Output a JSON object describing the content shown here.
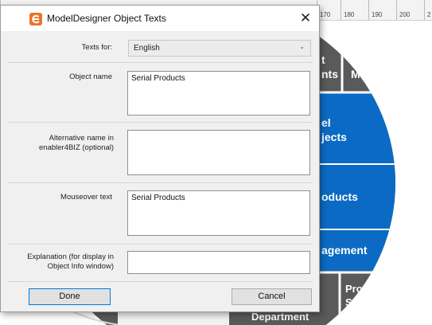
{
  "ruler": {
    "ticks": [
      "60",
      "170",
      "180",
      "190",
      "200",
      "2"
    ]
  },
  "background": {
    "labels": [
      {
        "id": "personel",
        "text": "Personel\nManagement"
      },
      {
        "id": "t-frag",
        "text": "t"
      },
      {
        "id": "nts-frag",
        "text": "nts"
      },
      {
        "id": "el-frag",
        "text": "el"
      },
      {
        "id": "jects-frag",
        "text": "jects"
      },
      {
        "id": "oducts-frag",
        "text": "oducts"
      },
      {
        "id": "agement-frag",
        "text": "agement"
      },
      {
        "id": "provide",
        "text": "Provide\nStandards"
      },
      {
        "id": "department",
        "text": "Department"
      }
    ],
    "colors": {
      "blue": "#0b6bc4",
      "blue_dark": "#0a5aa8",
      "gray": "#5a5a5a",
      "white": "#ffffff"
    }
  },
  "dialog": {
    "icon": "app-logo-icon",
    "title": "ModelDesigner Object Texts",
    "close_glyph": "✕",
    "texts_for_label": "Texts for:",
    "language_value": "English",
    "object_name_label": "Object name",
    "object_name_value": "Serial Products",
    "alt_name_label": "Alternative name in enabler4BIZ (optional)",
    "alt_name_value": "",
    "mouseover_label": "Mouseover text",
    "mouseover_value": "Serial Products",
    "explanation_label": "Explanation (for display in Object Info window)",
    "explanation_value": "",
    "done_label": "Done",
    "cancel_label": "Cancel"
  }
}
